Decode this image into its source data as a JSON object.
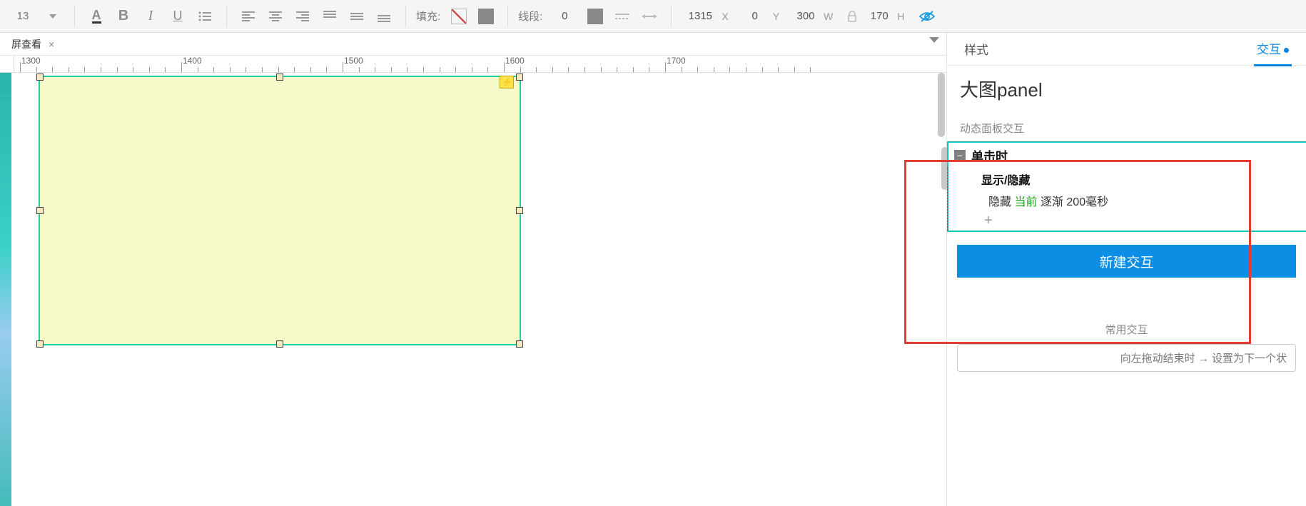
{
  "toolbar": {
    "font_size": "13",
    "fill_label": "填充:",
    "stroke_label": "线段:",
    "stroke_width": "0",
    "pos_x": "1315",
    "pos_y": "0",
    "size_w": "300",
    "size_h": "170",
    "suffix_x": "X",
    "suffix_y": "Y",
    "suffix_w": "W",
    "suffix_h": "H"
  },
  "doc_tab": {
    "label": "屏查看",
    "close": "×"
  },
  "ruler_labels": [
    "1300",
    "1400",
    "1500",
    "1600",
    "1700"
  ],
  "right_panel": {
    "tab_style": "样式",
    "tab_interact": "交互",
    "title": "大图panel",
    "section_label": "动态面板交互",
    "event": "单击时",
    "action": "显示/隐藏",
    "detail_hide": "隐藏",
    "detail_current": "当前",
    "detail_fade": "逐渐",
    "detail_duration": "200毫秒",
    "add": "+",
    "new_button": "新建交互",
    "common_label": "常用交互",
    "common_item": "向左拖动结束时 → 设置为下一个状"
  }
}
